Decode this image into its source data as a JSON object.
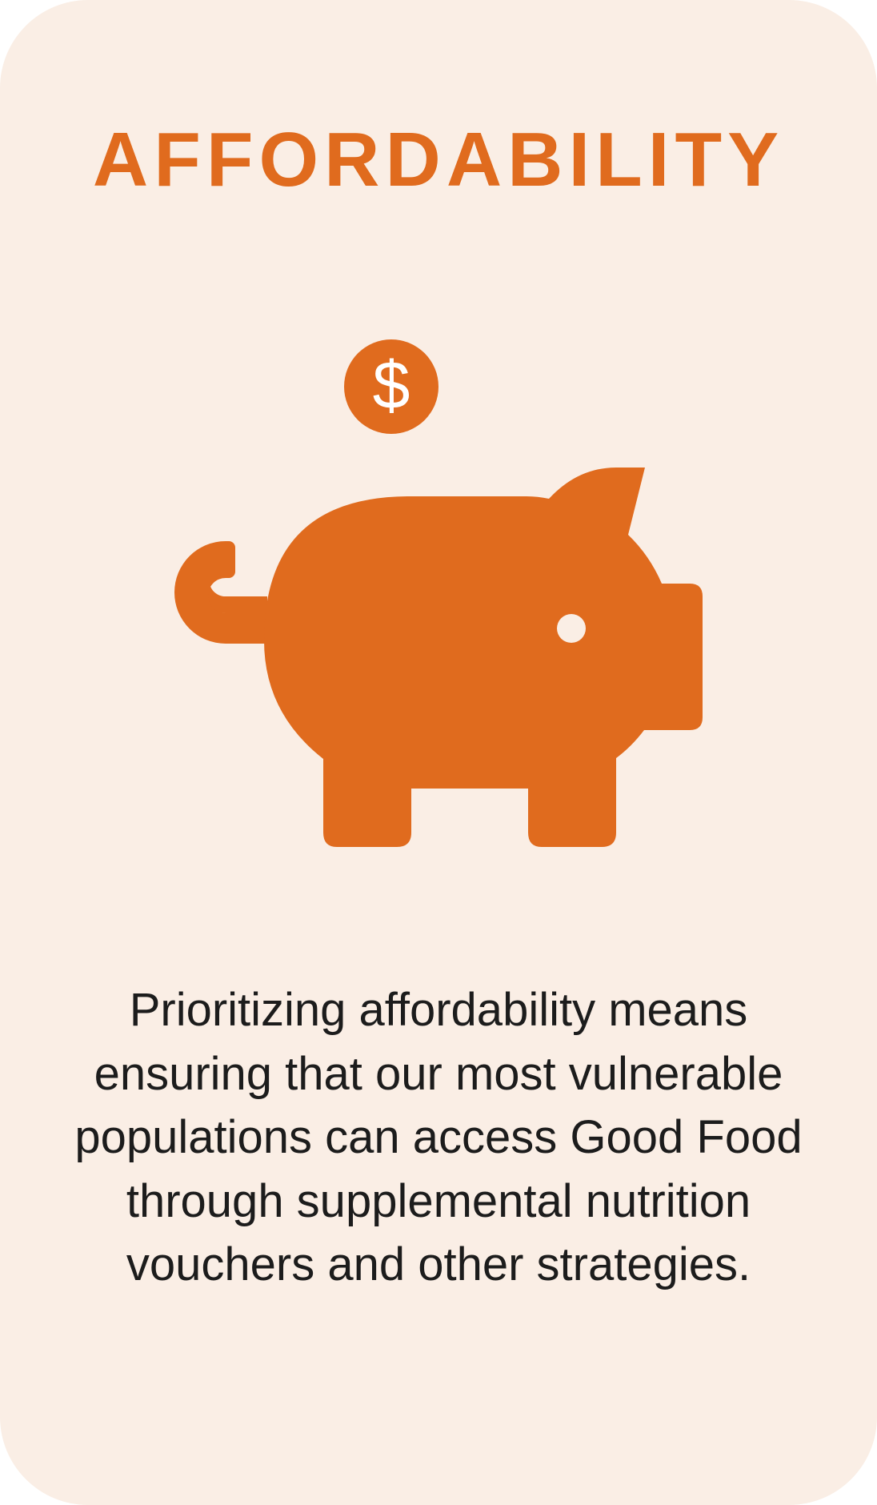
{
  "card": {
    "title": "AFFORDABILITY",
    "icon": "piggy-bank-with-dollar-coin",
    "coin_symbol": "$",
    "description": "Prioritizing affordability means ensuring that our most vulnerable populations can access Good Food through supplemental nutrition vouchers and other strategies."
  },
  "colors": {
    "background": "#faeee5",
    "accent": "#e06b1e",
    "text": "#1c1c1c"
  }
}
